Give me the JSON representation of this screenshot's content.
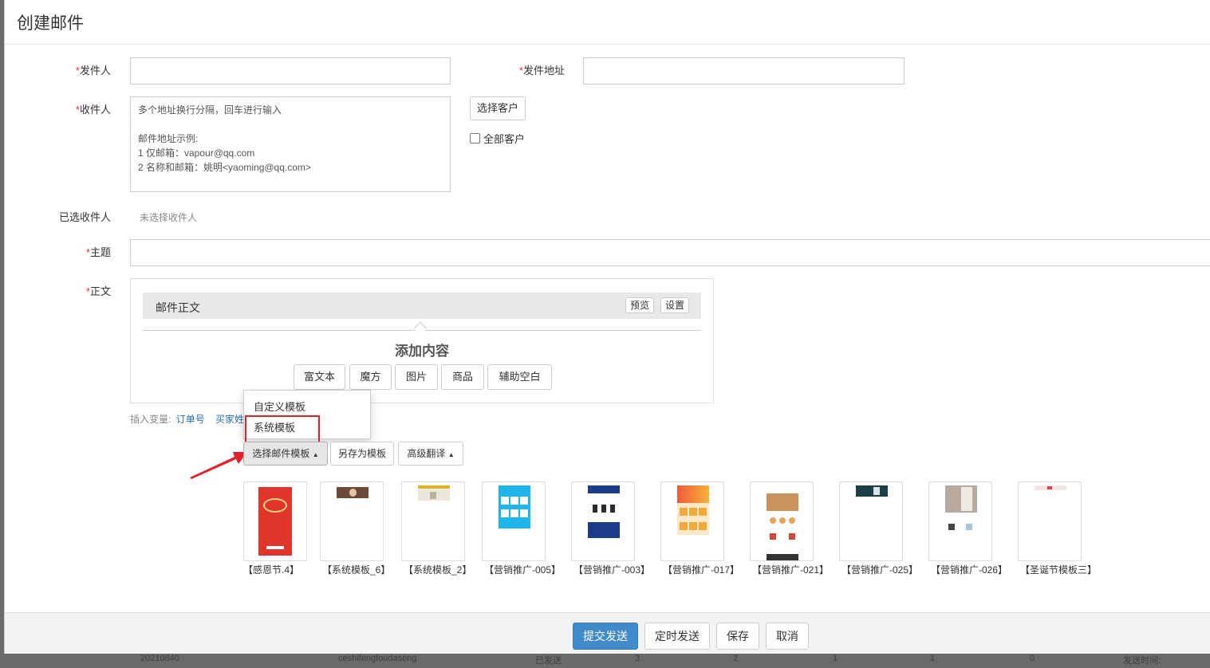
{
  "dialog": {
    "title": "创建邮件"
  },
  "form": {
    "sender_label": "发件人",
    "sender_address_label": "发件地址",
    "recipient_label": "收件人",
    "recipient_hint": [
      "多个地址换行分隔，回车进行输入",
      "",
      "邮件地址示例:",
      "1 仅邮箱：vapour@qq.com",
      "2 名称和邮箱：姚明<yaoming@qq.com>"
    ],
    "select_customer_button": "选择客户",
    "all_customers_label": "全部客户",
    "selected_recipients_label": "已选收件人",
    "selected_recipients_value": "未选择收件人",
    "subject_label": "主题",
    "body_label": "正文",
    "required_mark": "*"
  },
  "editor": {
    "bar_title": "邮件正文",
    "preview_button": "预览",
    "settings_button": "设置",
    "add_content_title": "添加内容",
    "content_buttons": [
      "富文本",
      "魔方",
      "图片",
      "商品",
      "辅助空白"
    ]
  },
  "variables": {
    "label": "插入变量:",
    "items": [
      "订单号",
      "买家姓名"
    ]
  },
  "template_menu": {
    "items": [
      "自定义模板",
      "系统模板"
    ]
  },
  "template_toolbar": {
    "select_template": "选择邮件模板",
    "save_as_template": "另存为模板",
    "advanced_translate": "高级翻译"
  },
  "templates": [
    {
      "name": "【感恩节.4】"
    },
    {
      "name": "【系统模板_6】"
    },
    {
      "name": "【系统模板_2】"
    },
    {
      "name": "【营销推广-005】"
    },
    {
      "name": "【营销推广-003】"
    },
    {
      "name": "【营销推广-017】"
    },
    {
      "name": "【营销推广-021】"
    },
    {
      "name": "【营销推广-025】"
    },
    {
      "name": "【营销推广-026】"
    },
    {
      "name": "【圣诞节模板三】"
    }
  ],
  "footer": {
    "submit": "提交发送",
    "scheduled_send": "定时发送",
    "save": "保存",
    "cancel": "取消"
  },
  "background_row": {
    "cells": [
      "20210840",
      "ceshifengfoudasong",
      "已发送",
      "3",
      "2",
      "1",
      "1",
      "0",
      "发送时间:"
    ]
  },
  "colors": {
    "required": "#ee3333",
    "primary": "#428bca",
    "link": "#2a6fb0",
    "highlight": "#e0202a"
  }
}
